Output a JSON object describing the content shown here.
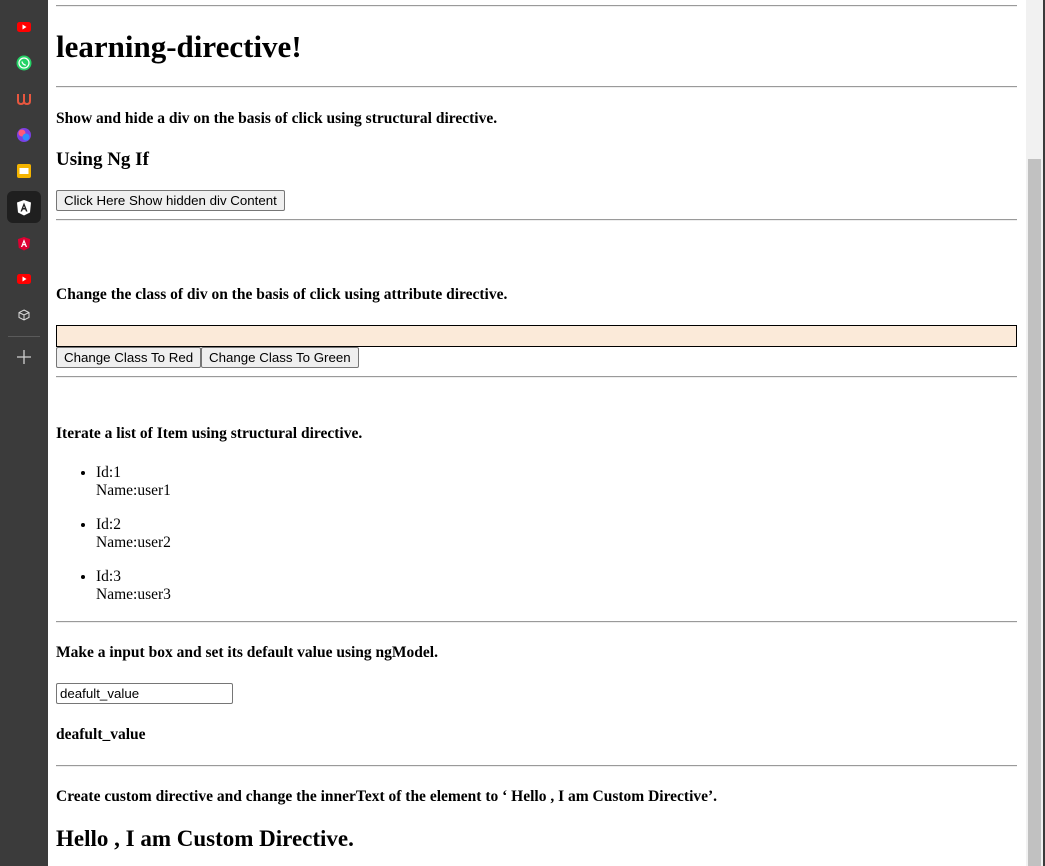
{
  "sidebar": {
    "icons": [
      "youtube-icon",
      "whatsapp-icon",
      "udemy-icon",
      "colorful-app-icon",
      "slides-icon",
      "angular-active-icon",
      "angular-icon",
      "youtube-icon",
      "package-icon",
      "add-icon"
    ]
  },
  "page": {
    "title": "learning-directive!",
    "section1": {
      "heading": "Show and hide a div on the basis of click using structural directive.",
      "subheading": "Using Ng If",
      "button_label": "Click Here Show hidden div Content"
    },
    "section2": {
      "heading": "Change the class of div on the basis of click using attribute directive.",
      "div_color": "#fbead9",
      "red_button_label": "Change Class To Red",
      "green_button_label": "Change Class To Green"
    },
    "section3": {
      "heading": "Iterate a list of Item using structural directive.",
      "items": [
        {
          "id": "Id:1",
          "name": "Name:user1"
        },
        {
          "id": "Id:2",
          "name": "Name:user2"
        },
        {
          "id": "Id:3",
          "name": "Name:user3"
        }
      ]
    },
    "section4": {
      "heading": "Make a input box and set its default value using ngModel.",
      "input_value": "deafult_value",
      "bound_value": "deafult_value"
    },
    "section5": {
      "heading": "Create custom directive and change the innerText of the element to ‘ Hello , I am Custom Directive’.",
      "result": "Hello , I am Custom Directive."
    }
  }
}
